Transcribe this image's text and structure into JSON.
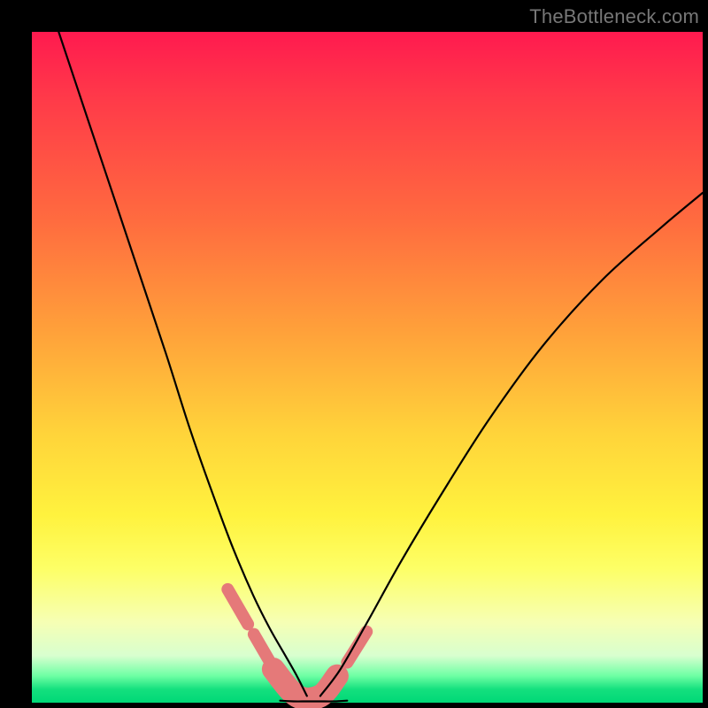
{
  "watermark": "TheBottleneck.com",
  "chart_data": {
    "type": "line",
    "title": "",
    "xlabel": "",
    "ylabel": "",
    "xlim": [
      0,
      1
    ],
    "ylim": [
      0,
      1
    ],
    "series": [
      {
        "name": "left-curve",
        "x": [
          0.04,
          0.08,
          0.12,
          0.16,
          0.2,
          0.235,
          0.27,
          0.3,
          0.33,
          0.355,
          0.378,
          0.395,
          0.41
        ],
        "y": [
          1.0,
          0.88,
          0.76,
          0.64,
          0.52,
          0.41,
          0.31,
          0.23,
          0.16,
          0.11,
          0.07,
          0.04,
          0.01
        ]
      },
      {
        "name": "right-curve",
        "x": [
          0.43,
          0.46,
          0.5,
          0.55,
          0.61,
          0.68,
          0.76,
          0.85,
          0.94,
          1.0
        ],
        "y": [
          0.01,
          0.05,
          0.12,
          0.21,
          0.31,
          0.42,
          0.53,
          0.63,
          0.71,
          0.76
        ]
      },
      {
        "name": "flat-bottom",
        "x": [
          0.37,
          0.39,
          0.41,
          0.43,
          0.45,
          0.47
        ],
        "y": [
          0.003,
          0.002,
          0.002,
          0.002,
          0.002,
          0.003
        ]
      }
    ],
    "highlight_segments": [
      {
        "name": "left-pink-upper",
        "x": [
          0.292,
          0.322
        ],
        "y": [
          0.169,
          0.117
        ]
      },
      {
        "name": "left-pink-lower",
        "x": [
          0.331,
          0.353
        ],
        "y": [
          0.102,
          0.064
        ]
      },
      {
        "name": "bottom-pink",
        "x": [
          0.36,
          0.395,
          0.43,
          0.455
        ],
        "y": [
          0.05,
          0.01,
          0.01,
          0.04
        ]
      },
      {
        "name": "right-pink",
        "x": [
          0.47,
          0.499
        ],
        "y": [
          0.06,
          0.106
        ]
      }
    ],
    "background": {
      "gradient_stops": [
        {
          "pos": 0.0,
          "color": "#ff1a4f"
        },
        {
          "pos": 0.28,
          "color": "#ff6b3f"
        },
        {
          "pos": 0.6,
          "color": "#ffd43a"
        },
        {
          "pos": 0.88,
          "color": "#f6ffb4"
        },
        {
          "pos": 1.0,
          "color": "#00d877"
        }
      ]
    }
  }
}
